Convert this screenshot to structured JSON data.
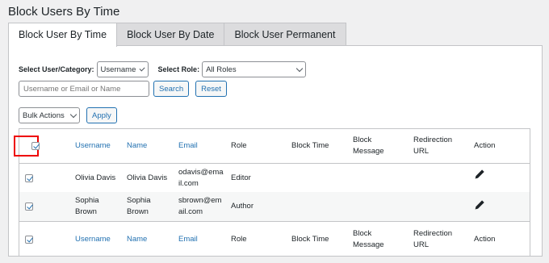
{
  "page_title": "Block Users By Time",
  "tabs": [
    {
      "label": "Block User By Time",
      "active": true
    },
    {
      "label": "Block User By Date",
      "active": false
    },
    {
      "label": "Block User Permanent",
      "active": false
    }
  ],
  "filters": {
    "user_category_label": "Select User/Category:",
    "user_category_value": "Username",
    "role_label": "Select Role:",
    "role_value": "All Roles",
    "search_placeholder": "Username or Email or Name",
    "search_button": "Search",
    "reset_button": "Reset"
  },
  "bulk": {
    "select_value": "Bulk Actions",
    "apply_button": "Apply"
  },
  "table": {
    "columns": {
      "username": "Username",
      "name": "Name",
      "email": "Email",
      "role": "Role",
      "block_time": "Block Time",
      "block_message_1": "Block",
      "block_message_2": "Message",
      "redirection_url_1": "Redirection",
      "redirection_url_2": "URL",
      "action": "Action"
    },
    "rows": [
      {
        "username": "Olivia Davis",
        "name": "Olivia Davis",
        "email_1": "odavis@ema",
        "email_2": "il.com",
        "role": "Editor",
        "checked": true
      },
      {
        "username_1": "Sophia",
        "username_2": "Brown",
        "name_1": "Sophia",
        "name_2": "Brown",
        "email_1": "sbrown@em",
        "email_2": "ail.com",
        "role": "Author",
        "checked": true
      }
    ]
  },
  "icons": {
    "edit": "pencil-icon",
    "dropdown": "chevron-down-icon"
  },
  "colors": {
    "link": "#2271b1",
    "highlight": "#e00000",
    "background": "#f0f0f1"
  }
}
